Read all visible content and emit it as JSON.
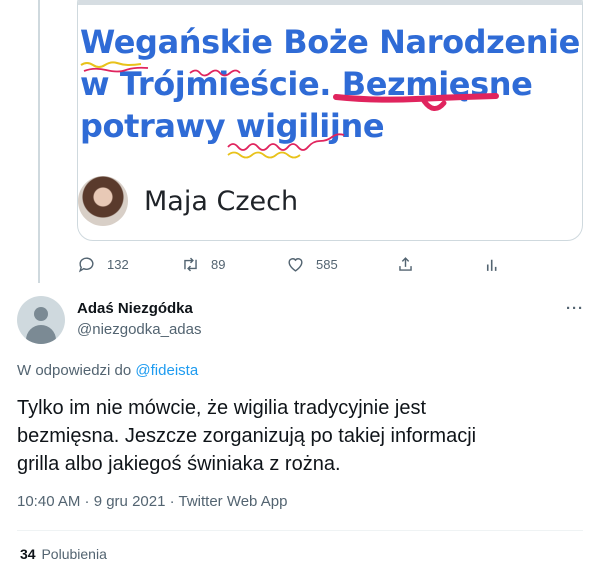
{
  "quoted_card": {
    "headline_lines": [
      "Wegańskie Boże Narodzenie",
      "w Trójmieście. Bezmięsne",
      "potrawy wigilijne"
    ],
    "author": "Maja Czech"
  },
  "parent_actions": {
    "replies": "132",
    "retweets": "89",
    "likes": "585"
  },
  "tweet": {
    "display_name": "Adaś Niezgódka",
    "handle": "@niezgodka_adas",
    "more": "···",
    "reply_prefix": "W odpowiedzi do ",
    "reply_handle": "@fideista",
    "text_lines": [
      "Tylko im nie mówcie, że wigilia tradycyjnie jest",
      "bezmięsna. Jeszcze zorganizują po takiej informacji",
      "grilla albo jakiegoś świniaka z rożna."
    ],
    "meta": "10:40 AM · 9 gru 2021 · Twitter Web App",
    "likes_count": "34",
    "likes_label": "Polubienia"
  },
  "colors": {
    "headline": "#2f6bd6",
    "scribble_red": "#e0245e",
    "scribble_yellow": "#e8c21a",
    "link": "#1d9bf0"
  },
  "icons": [
    "reply-icon",
    "retweet-icon",
    "like-icon",
    "share-icon",
    "analytics-icon",
    "more-icon"
  ]
}
